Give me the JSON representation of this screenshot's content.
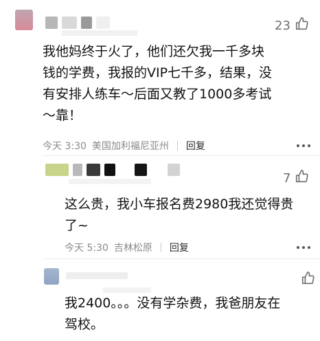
{
  "comments": [
    {
      "likes": "23",
      "text_lines": [
        "我他妈终于火了，他们还欠我一千多块",
        "钱的学费，我报的VIP七千多，结果，没",
        "有安排人练车～后面又教了1000多考试",
        "～靠！"
      ],
      "time": "今天 3:30",
      "location": "美国加利福尼亚州",
      "reply_label": "回复"
    },
    {
      "likes": "7",
      "text_lines": [
        "这么贵，我小车报名费2980我还觉得贵",
        "了~"
      ],
      "time": "今天 5:30",
      "location": "吉林松原",
      "reply_label": "回复"
    },
    {
      "likes": "",
      "text_lines": [
        "我2400。。。没有学杂费，我爸朋友在",
        "驾校。"
      ]
    }
  ],
  "colors": {
    "avatar1": "#d98a9a",
    "avatar2": "#c8d48a",
    "avatar3": "#8fa3c4",
    "blur_gray": "#cfcfcf",
    "blur_dark": "#3a3a3a"
  }
}
